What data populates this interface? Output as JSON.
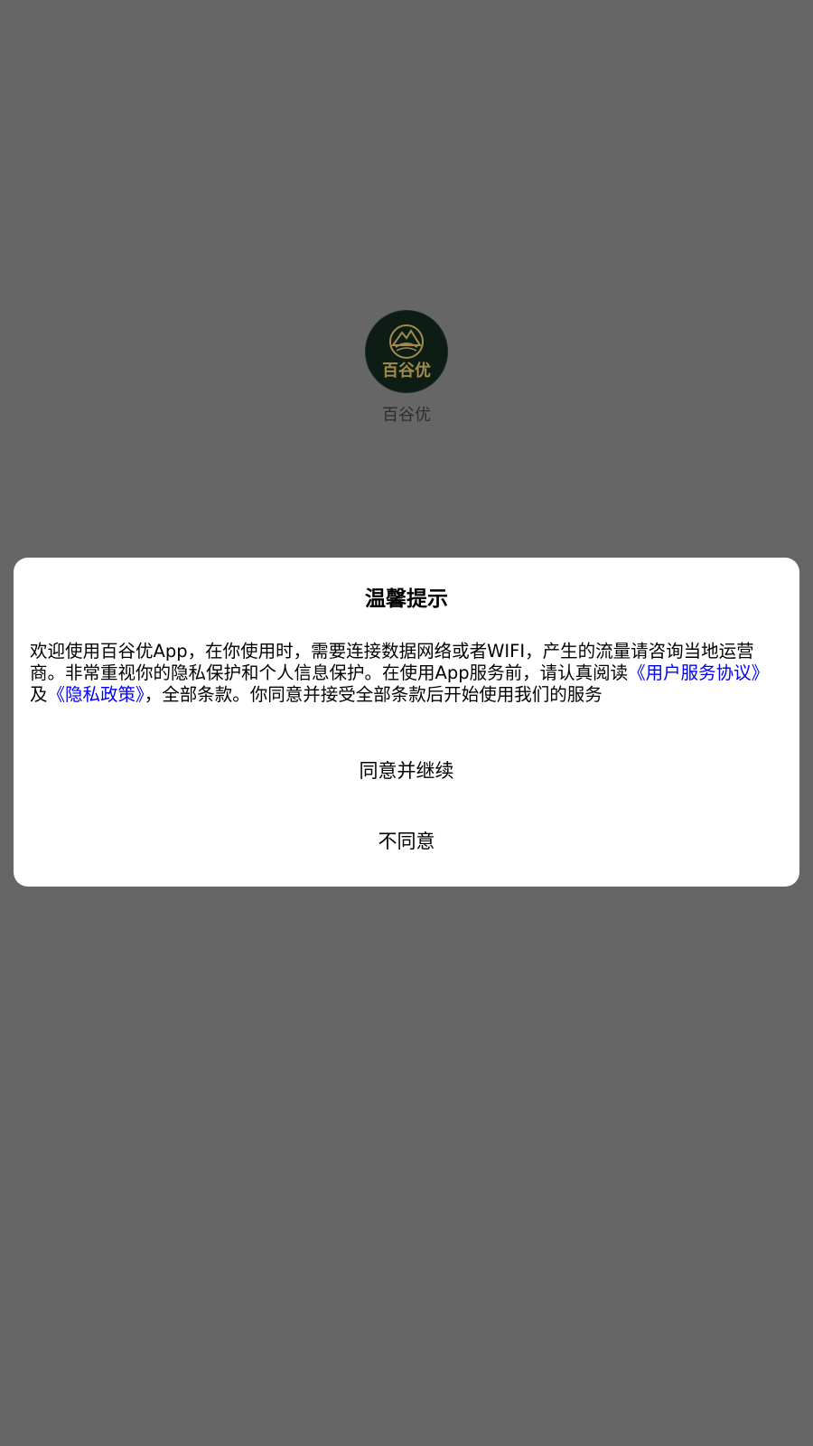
{
  "splash": {
    "app_name": "百谷优",
    "logo_icon": "baiguyou-logo-icon",
    "logo_text": "百谷优"
  },
  "dialog": {
    "title": "温馨提示",
    "body_prefix": "欢迎使用百谷优App，在你使用时，需要连接数据网络或者WIFI，产生的流量请咨询当地运营商。非常重视你的隐私保护和个人信息保护。在使用App服务前，请认真阅读",
    "link_user_agreement": "《用户服务协议》",
    "joiner": "及",
    "link_privacy_policy": "《隐私政策》",
    "body_suffix": "，全部条款。你同意并接受全部条款后开始使用我们的服务",
    "agree_label": "同意并继续",
    "disagree_label": "不同意"
  },
  "colors": {
    "backdrop": "#666666",
    "dialog_bg": "#ffffff",
    "link": "#0000ee",
    "logo_bg": "#0d1d16",
    "logo_gold": "#a08a4c"
  }
}
